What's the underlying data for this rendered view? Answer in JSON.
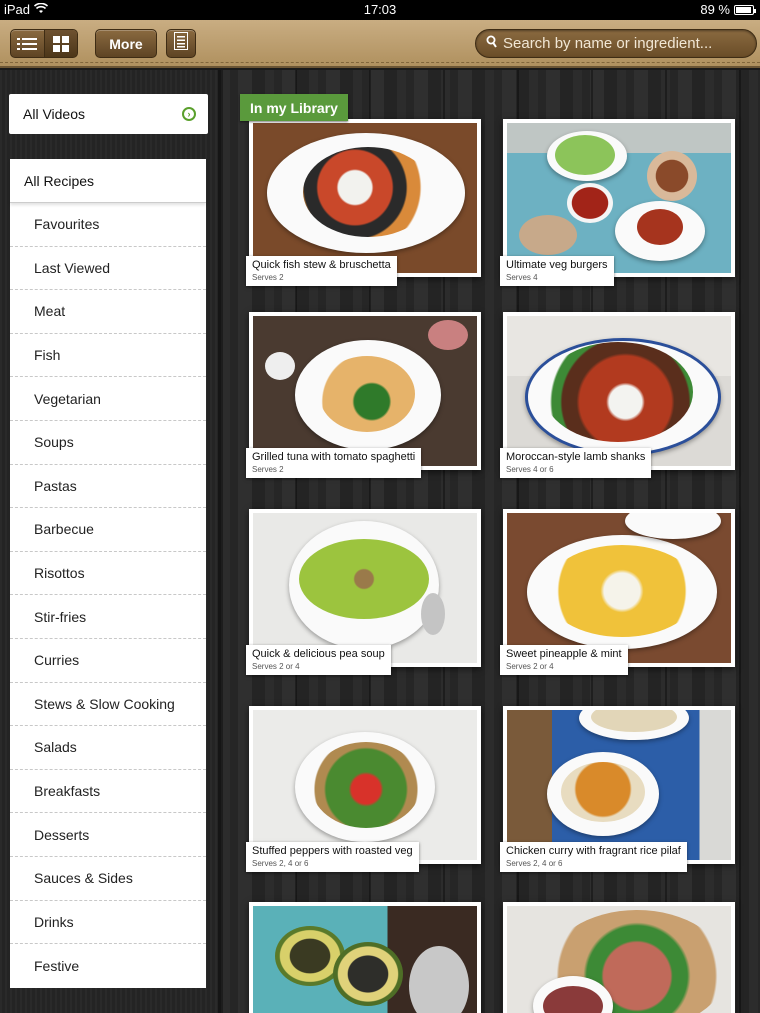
{
  "status": {
    "carrier": "iPad",
    "time": "17:03",
    "battery": "89 %"
  },
  "toolbar": {
    "more_label": "More",
    "search_placeholder": "Search by name or ingredient..."
  },
  "sidebar": {
    "all_videos": "All Videos",
    "all_recipes": "All Recipes",
    "items": [
      "Favourites",
      "Last Viewed",
      "Meat",
      "Fish",
      "Vegetarian",
      "Soups",
      "Pastas",
      "Barbecue",
      "Risottos",
      "Stir-fries",
      "Curries",
      "Stews & Slow Cooking",
      "Salads",
      "Breakfasts",
      "Desserts",
      "Sauces & Sides",
      "Drinks",
      "Festive"
    ]
  },
  "main": {
    "library_label": "In my Library",
    "recipes": [
      {
        "title": "Quick fish stew & bruschetta",
        "serves": "Serves 2"
      },
      {
        "title": "Ultimate veg burgers",
        "serves": "Serves 4"
      },
      {
        "title": "Grilled tuna with tomato spaghetti",
        "serves": "Serves 2"
      },
      {
        "title": "Moroccan-style lamb shanks",
        "serves": "Serves 4 or 6"
      },
      {
        "title": "Quick & delicious pea soup",
        "serves": "Serves 2 or 4"
      },
      {
        "title": "Sweet pineapple & mint",
        "serves": "Serves 2 or 4"
      },
      {
        "title": "Stuffed peppers with roasted veg",
        "serves": "Serves 2, 4 or 6"
      },
      {
        "title": "Chicken curry with fragrant rice pilaf",
        "serves": "Serves 2, 4 or 6"
      }
    ]
  }
}
